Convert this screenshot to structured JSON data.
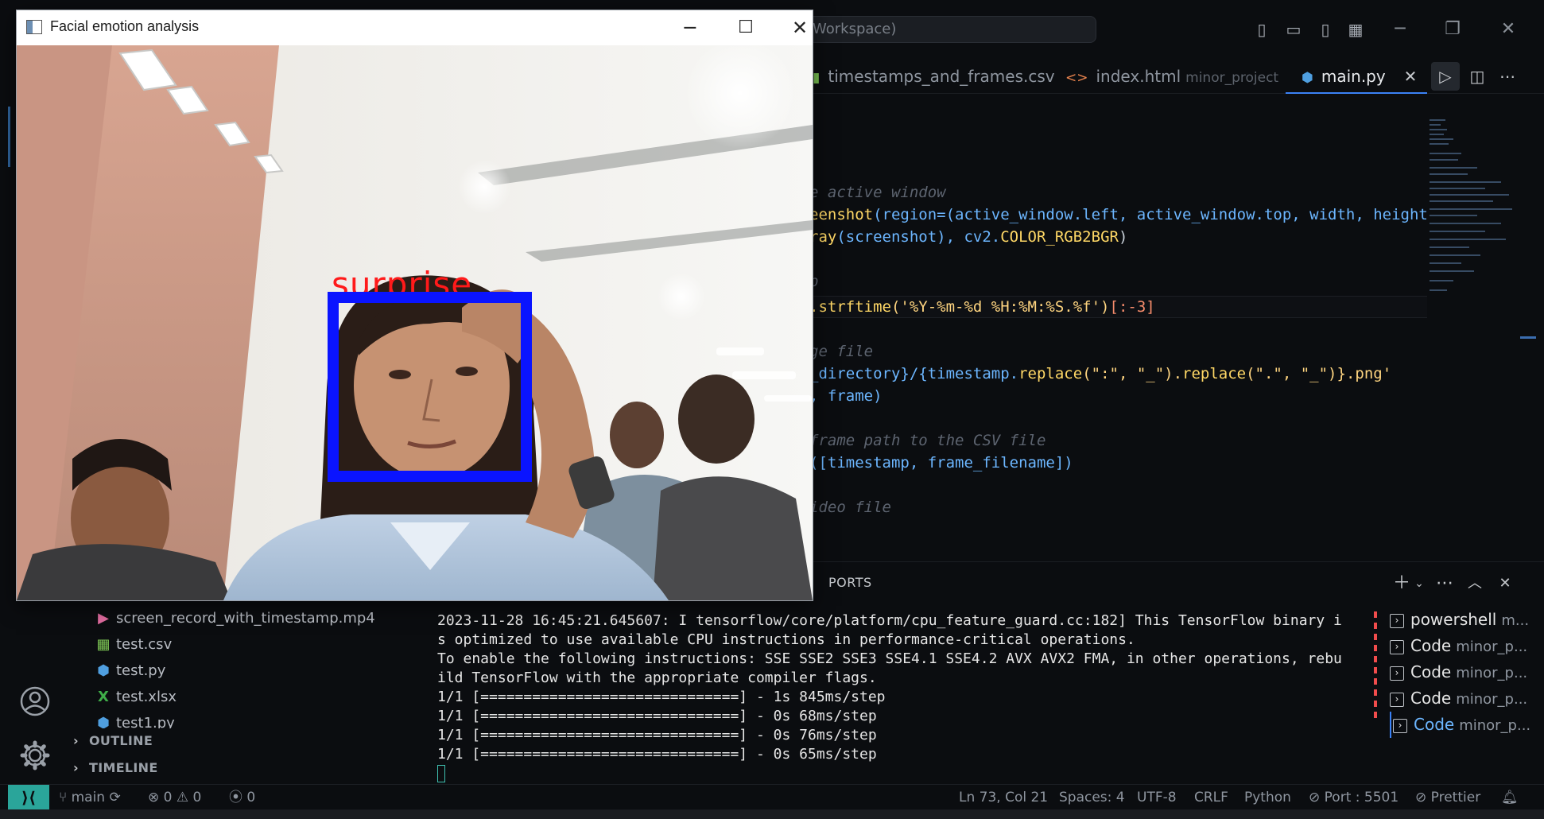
{
  "vscode": {
    "title_search": "Workspace)",
    "tabs": [
      {
        "label": "timestamps_and_frames.csv",
        "sub": ""
      },
      {
        "label": "index.html",
        "sub": "minor_project"
      },
      {
        "label": "main.py",
        "sub": ""
      }
    ],
    "code_lines": [
      {
        "cmt": "e active window"
      },
      {
        "a": "eenshot",
        "b": "(region=(active_window.left, active_window.top, width, height"
      },
      {
        "a": "ray",
        "b": "(screenshot), cv2.",
        "c": "COLOR_RGB2BGR",
        "d": ")"
      },
      {
        "cmt": "p"
      },
      {
        "a": ".strftime",
        "b": "('%Y-%m-%d %H:%M:%S.%f')",
        "c": "[:-3]"
      },
      {
        "cmt": "ge file"
      },
      {
        "a": "_directory}/{timestamp.",
        "b": "replace",
        "c": "(\":\", \"_\").",
        "d": "replace",
        "e": "(\".\", \"_\")}.png'"
      },
      {
        "a": ", frame)"
      },
      {
        "cmt": "frame path to the CSV file"
      },
      {
        "a": "([timestamp, frame_filename])"
      },
      {
        "cmt": "ideo file"
      }
    ],
    "panel": {
      "tab": "PORTS",
      "terminal_lines": [
        "2023-11-28 16:45:21.645607: I tensorflow/core/platform/cpu_feature_guard.cc:182] This TensorFlow binary i",
        "s optimized to use available CPU instructions in performance-critical operations.",
        "To enable the following instructions: SSE SSE2 SSE3 SSE4.1 SSE4.2 AVX AVX2 FMA, in other operations, rebu",
        "ild TensorFlow with the appropriate compiler flags.",
        "1/1 [==============================] - 1s 845ms/step",
        "1/1 [==============================] - 0s 68ms/step",
        "1/1 [==============================] - 0s 76ms/step",
        "1/1 [==============================] - 0s 65ms/step"
      ],
      "terminals": [
        {
          "name": "powershell",
          "sub": "m..."
        },
        {
          "name": "Code",
          "sub": "minor_p..."
        },
        {
          "name": "Code",
          "sub": "minor_p..."
        },
        {
          "name": "Code",
          "sub": "minor_p..."
        },
        {
          "name": "Code",
          "sub": "minor_p..."
        }
      ]
    },
    "explorer": {
      "files": [
        {
          "name": "screen_record_with_timestamp.mp4",
          "icon": "video-file-icon",
          "color": "#e06c9f"
        },
        {
          "name": "test.csv",
          "icon": "csv-file-icon",
          "color": "#7ec855"
        },
        {
          "name": "test.py",
          "icon": "python-file-icon",
          "color": "#4f9fe0"
        },
        {
          "name": "test.xlsx",
          "icon": "excel-file-icon",
          "color": "#3fae49"
        },
        {
          "name": "test1.py",
          "icon": "python-file-icon",
          "color": "#4f9fe0"
        }
      ],
      "outline": "OUTLINE",
      "timeline": "TIMELINE"
    },
    "status": {
      "branch": "main",
      "errors": "0",
      "warnings": "0",
      "ports": "0",
      "position": "Ln 73, Col 21",
      "spaces": "Spaces: 4",
      "encoding": "UTF-8",
      "eol": "CRLF",
      "language": "Python",
      "port": "Port : 5501",
      "prettier": "Prettier"
    }
  },
  "camera_window": {
    "title": "Facial emotion analysis",
    "emotion": "surprise",
    "box_color": "#0a14ff",
    "label_color": "#ff1a1a"
  }
}
